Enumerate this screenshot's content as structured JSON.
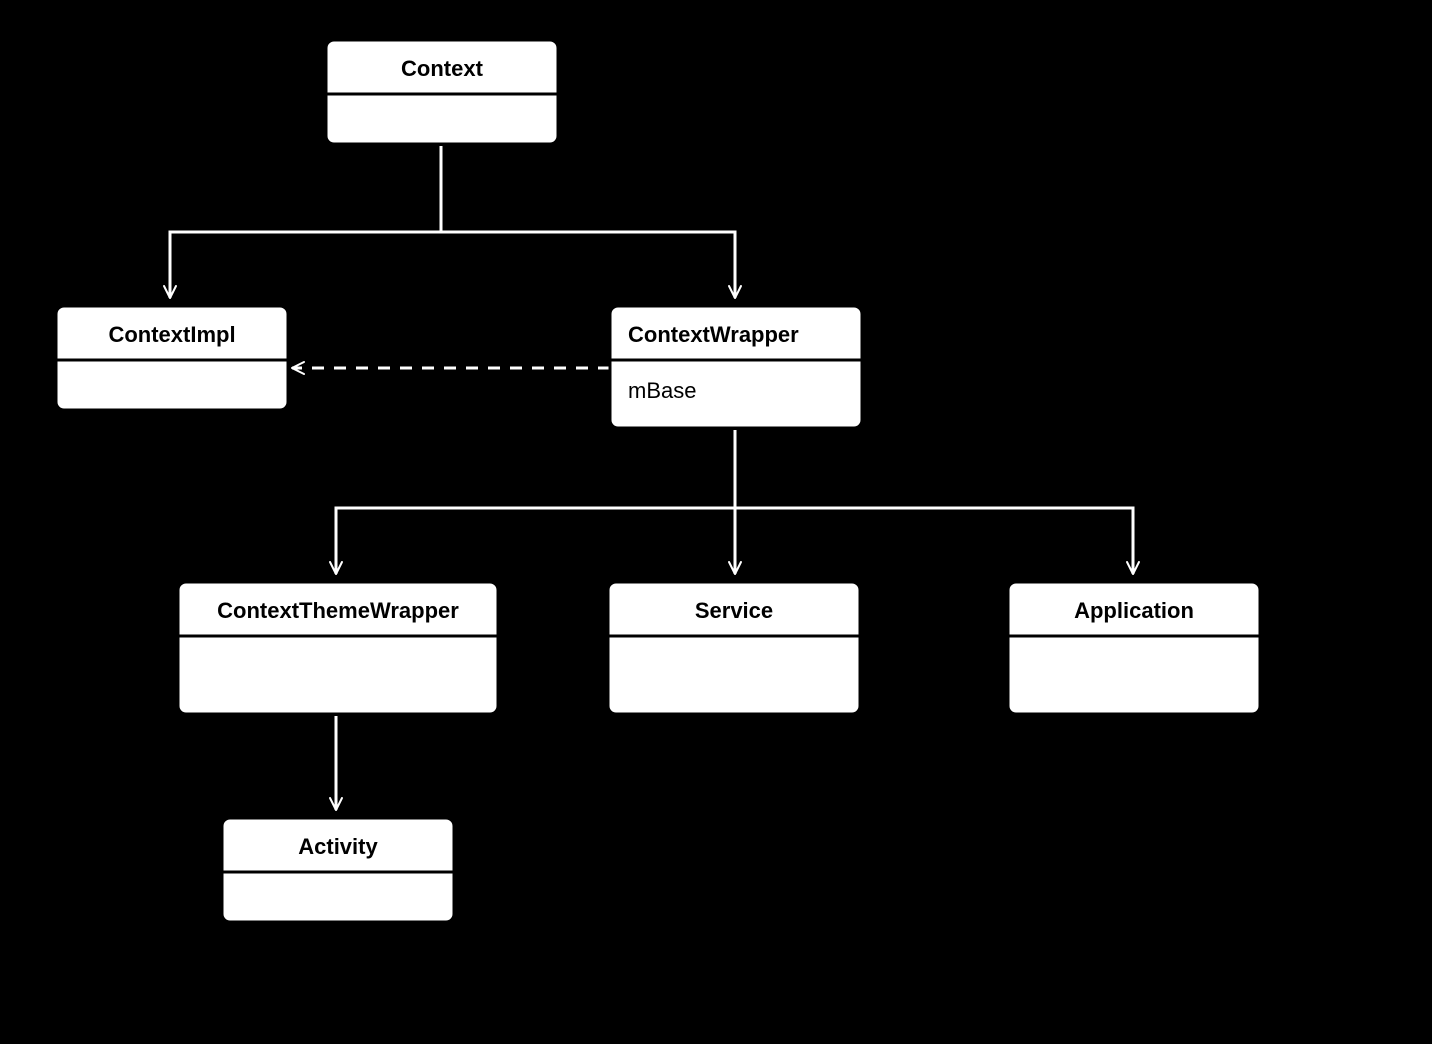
{
  "nodes": {
    "context": {
      "name": "Context",
      "attrs": []
    },
    "contextImpl": {
      "name": "ContextImpl",
      "attrs": []
    },
    "contextWrapper": {
      "name": "ContextWrapper",
      "attrs": [
        "mBase"
      ]
    },
    "contextThemeWrapper": {
      "name": "ContextThemeWrapper",
      "attrs": []
    },
    "service": {
      "name": "Service",
      "attrs": []
    },
    "application": {
      "name": "Application",
      "attrs": []
    },
    "activity": {
      "name": "Activity",
      "attrs": []
    }
  }
}
